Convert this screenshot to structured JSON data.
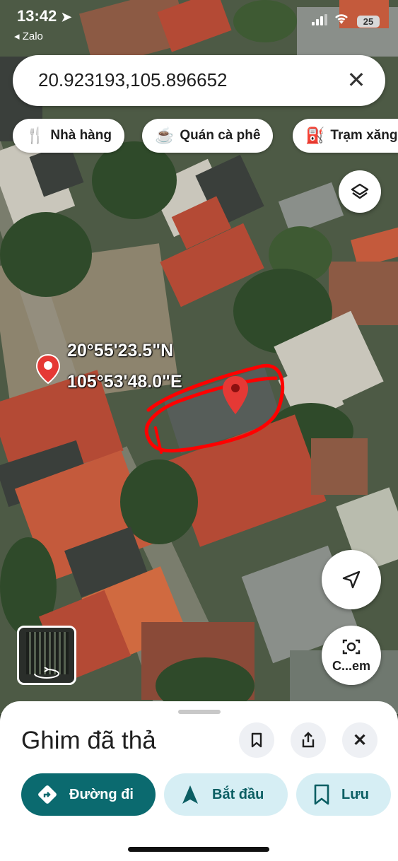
{
  "status_bar": {
    "time": "13:42",
    "back_app": "◂ Zalo",
    "battery": "25"
  },
  "search": {
    "value": "20.923193,105.896652"
  },
  "chips": [
    {
      "label": "Nhà hàng",
      "icon": "fork-knife-icon"
    },
    {
      "label": "Quán cà phê",
      "icon": "coffee-cup-icon"
    },
    {
      "label": "Trạm xăng",
      "icon": "gas-station-icon"
    }
  ],
  "map": {
    "pin_lat": "20°55'23.5\"N",
    "pin_lng": "105°53'48.0\"E",
    "street_view_label": "C...em",
    "colors": {
      "pin": "#e53935",
      "annotation": "#ff0000"
    }
  },
  "sheet": {
    "title": "Ghim đã thả",
    "actions": [
      {
        "label": "Đường đi",
        "icon": "directions-icon"
      },
      {
        "label": "Bắt đầu",
        "icon": "navigation-arrow-icon"
      },
      {
        "label": "Lưu",
        "icon": "bookmark-icon"
      }
    ]
  },
  "colors": {
    "primary": "#0b6a6f",
    "secondary_bg": "#d6eef4",
    "secondary_text": "#0b5e63"
  }
}
